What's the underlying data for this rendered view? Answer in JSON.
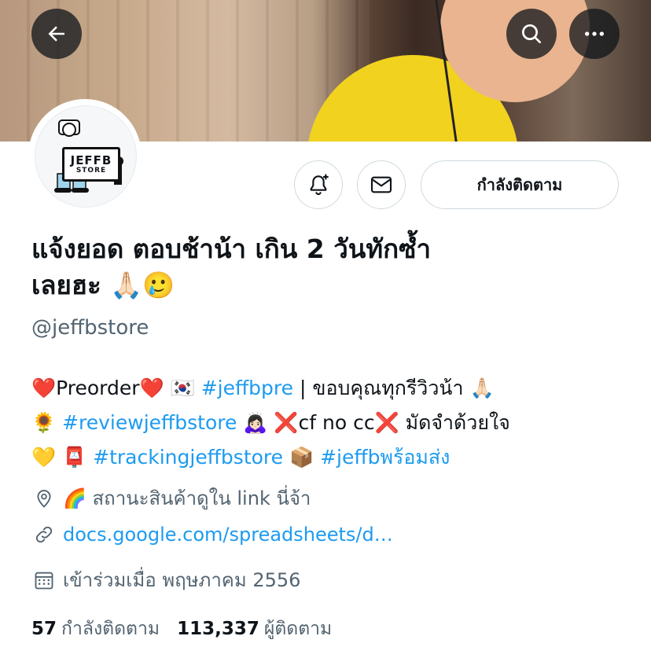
{
  "header": {
    "back_icon": "arrow-left-icon",
    "search_icon": "search-icon",
    "more_icon": "more-horizontal-icon"
  },
  "avatar": {
    "line1": "JEFFB",
    "line2": "STORE"
  },
  "actions": {
    "notify_icon": "bell-plus-icon",
    "message_icon": "mail-icon",
    "following_label": "กำลังติดตาม"
  },
  "profile": {
    "display_name_line1": "แจ้งยอด ตอบช้าน้า เกิน 2 วันทักซ้ำ",
    "display_name_line2": "เลยฮะ 🙏🏻🥲",
    "handle": "@jeffbstore",
    "bio": {
      "l1_a": "❤️Preorder❤️ 🇰🇷 ",
      "l1_tag": "#jeffbpre",
      "l1_b": " | ขอบคุณทุกรีวิวน้า 🙏🏻",
      "l2_a": "🌻 ",
      "l2_tag": "#reviewjeffbstore",
      "l2_b": " 🙇🏻‍♀️ ❌cf no cc❌ มัดจำด้วยใจ",
      "l3_a": "💛 📮 ",
      "l3_tag1": "#trackingjeffbstore",
      "l3_b": " 📦 ",
      "l3_tag2": "#jeffbพร้อมส่ง"
    },
    "location": "🌈 สถานะสินค้าดูใน link นี่จ้า",
    "link": "docs.google.com/spreadsheets/d…",
    "joined": "เข้าร่วมเมื่อ พฤษภาคม 2556",
    "following_count": "57",
    "following_label": "กำลังติดตาม",
    "followers_count": "113,337",
    "followers_label": "ผู้ติดตาม"
  },
  "colors": {
    "accent": "#1d9bf0",
    "secondary_text": "#536471",
    "primary_text": "#0f1419",
    "border": "#cfd9de"
  }
}
